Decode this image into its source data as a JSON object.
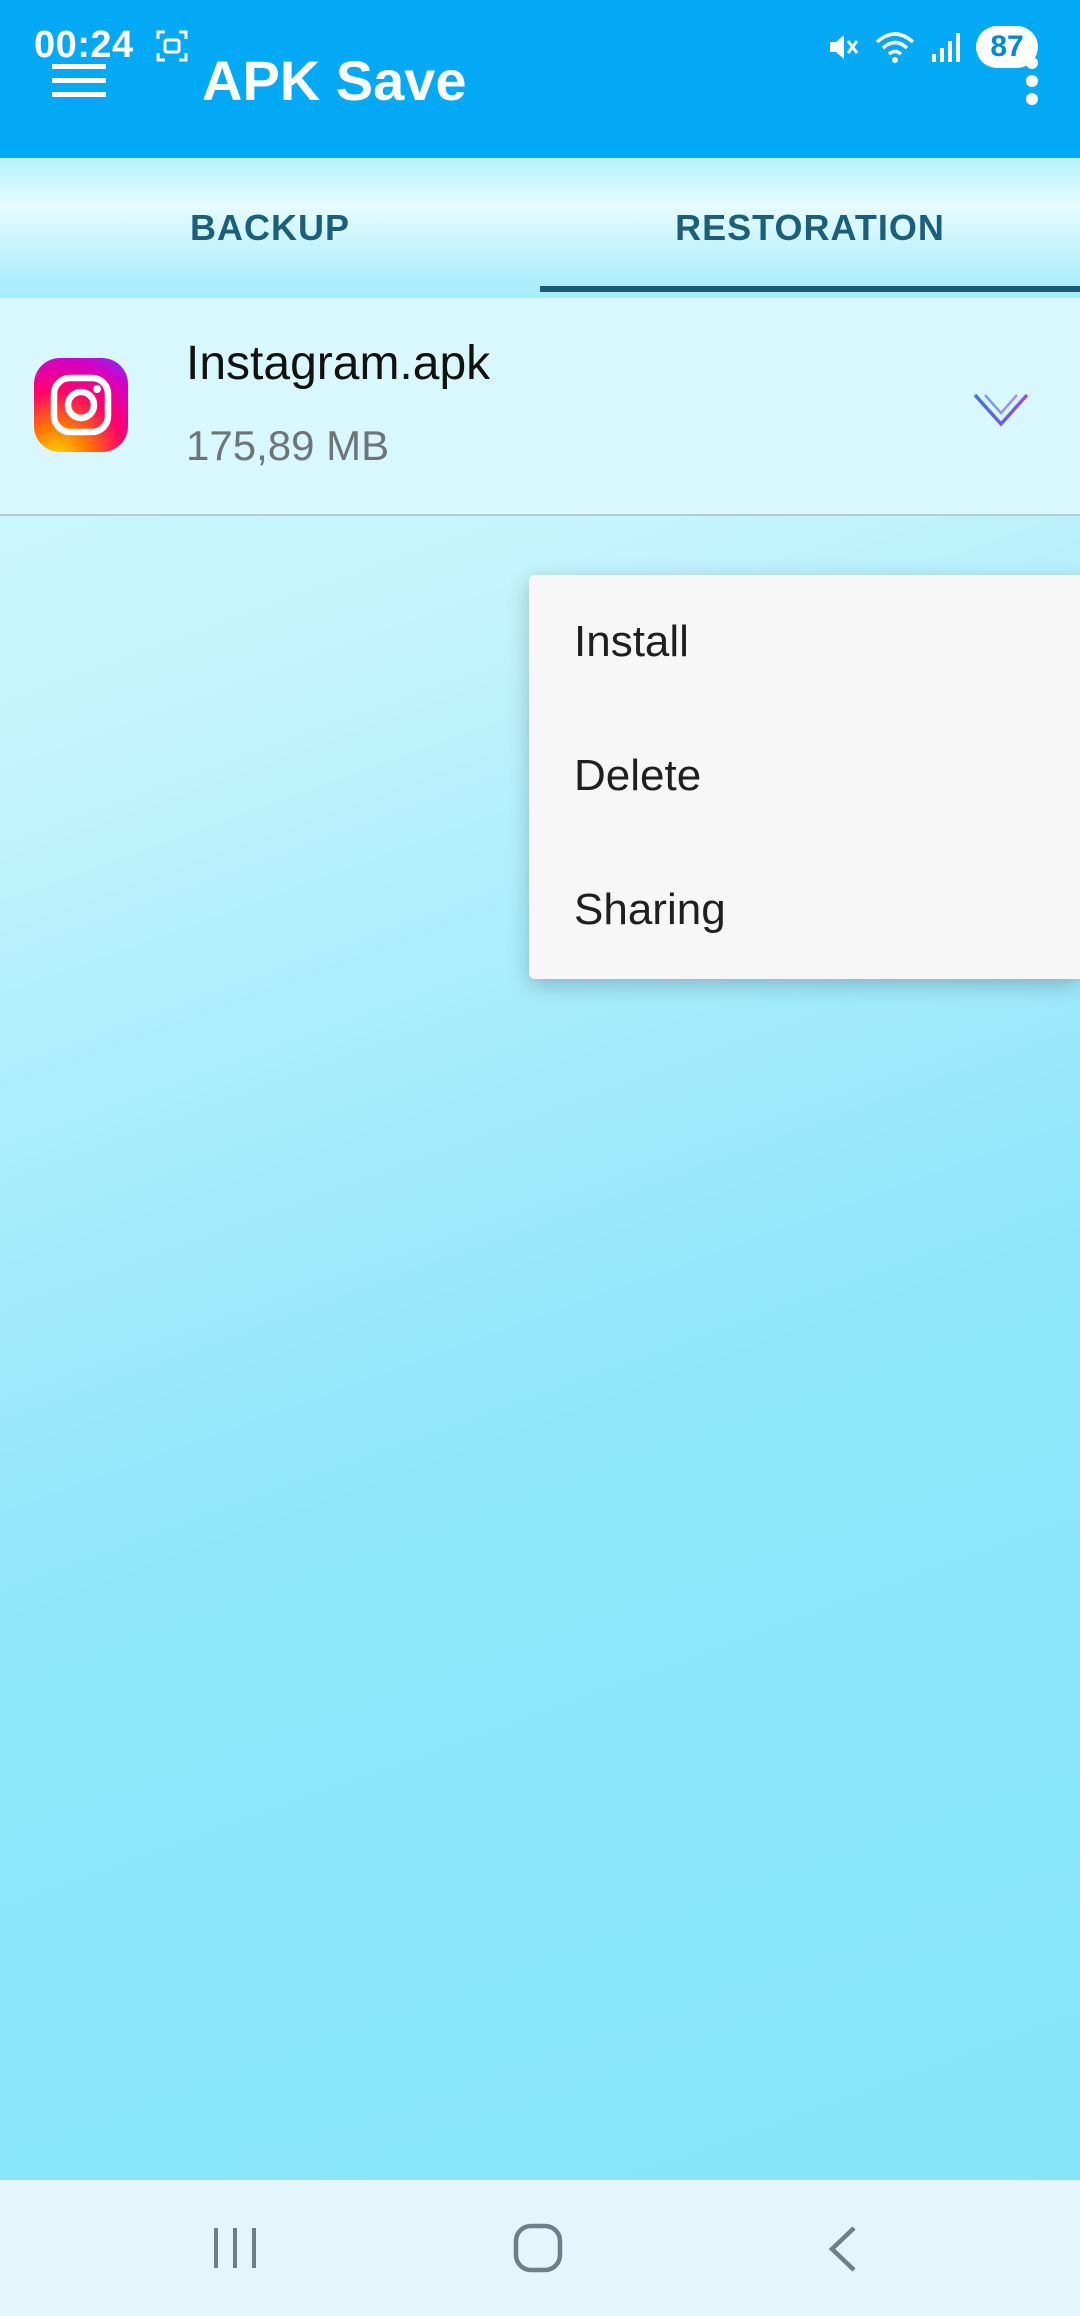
{
  "status_bar": {
    "time": "00:24",
    "battery": "87",
    "icons": [
      "screenshot-icon",
      "mute-icon",
      "wifi-icon",
      "signal-icon"
    ]
  },
  "app_bar": {
    "title": "APK Save",
    "menu_icon": "hamburger-menu-icon",
    "overflow_icon": "more-vert-icon",
    "color": "#03a9f4"
  },
  "tabs": [
    {
      "label": "BACKUP",
      "selected": false
    },
    {
      "label": "RESTORATION",
      "selected": true
    }
  ],
  "apk_list": [
    {
      "name": "Instagram.apk",
      "size": "175,89 MB",
      "icon": "instagram-icon",
      "action_icon": "chevron-down-icon"
    }
  ],
  "context_menu": {
    "items": [
      "Install",
      "Delete",
      "Sharing"
    ]
  },
  "nav_bar": {
    "icons": [
      "recent-apps-icon",
      "home-icon",
      "back-icon"
    ]
  },
  "colors": {
    "accent": "#03a9f4",
    "tab_text": "#1b5f7a",
    "tab_indicator": "#1b5a78",
    "background": "#86e5fb"
  }
}
